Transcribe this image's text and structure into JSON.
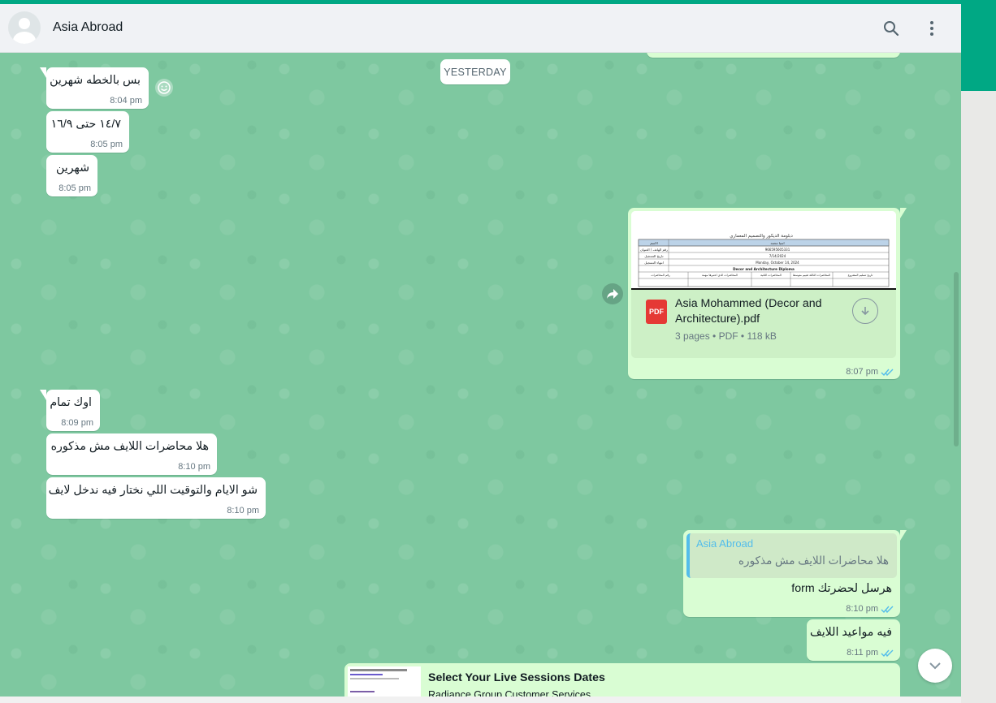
{
  "header": {
    "contact_name": "Asia Abroad"
  },
  "date_divider": "YESTERDAY",
  "messages": [
    {
      "text": "بس بالخطه شهرين",
      "time": "8:04 pm"
    },
    {
      "text": "١٤/٧ حتى ١٦/٩",
      "time": "8:05 pm"
    },
    {
      "text": "شهرين",
      "time": "8:05 pm"
    },
    {
      "doc_name": "Asia Mohammed (Decor and Architecture).pdf",
      "doc_name_line1": "Asia Mohammed (Decor and",
      "doc_name_line2": "Architecture).pdf",
      "doc_meta": "3 pages • PDF • 118 kB",
      "doc_badge": "PDF",
      "time": "8:07 pm"
    },
    {
      "text": "اوك تمام",
      "time": "8:09 pm"
    },
    {
      "text": "هلا محاضرات اللايف  مش مذكوره",
      "time": "8:10 pm"
    },
    {
      "text": "شو الايام والتوقيت اللي نختار فيه ندخل لايف",
      "time": "8:10 pm"
    },
    {
      "quote_author": "Asia Abroad",
      "quote_text": "هلا محاضرات اللايف  مش مذكوره",
      "text": "هرسل لحضرتك form",
      "time": "8:10 pm"
    },
    {
      "text": "فيه مواعيد اللايف",
      "time": "8:11 pm"
    },
    {
      "link_title": "Select Your Live Sessions Dates",
      "link_sub": "Radiance Group Customer Services"
    }
  ],
  "doc_preview": {
    "title": "دبلومة الديكور والتصميم المعماري",
    "rows": [
      [
        "الاسم",
        "اسيا محمد"
      ],
      [
        "رقم الهاتف / العنوان",
        "966595605331"
      ],
      [
        "تاريخ التسجيل",
        "7/14/2024"
      ],
      [
        "انتهاء التسجيل",
        "Monday, October 14, 2024"
      ]
    ],
    "course": "Decor and Architecture Diploma",
    "columns": [
      "رقم المحاضرات",
      "المحاضرات الذي اعتبرها مهمة",
      "المحاضرات الثانية",
      "المحاضرات الثالثة تقييم متوسط",
      "تاريخ تسليم المشروع"
    ]
  },
  "colors": {
    "accent": "#00a884",
    "chat_bg": "#7ec8a0",
    "incoming": "#ffffff",
    "outgoing": "#d9fdd3",
    "read_ticks": "#53bdeb"
  },
  "icons": [
    "search-icon",
    "menu-icon",
    "smiley-icon",
    "forward-icon",
    "pdf-icon",
    "download-icon",
    "chevron-down-icon",
    "read-ticks-icon"
  ]
}
